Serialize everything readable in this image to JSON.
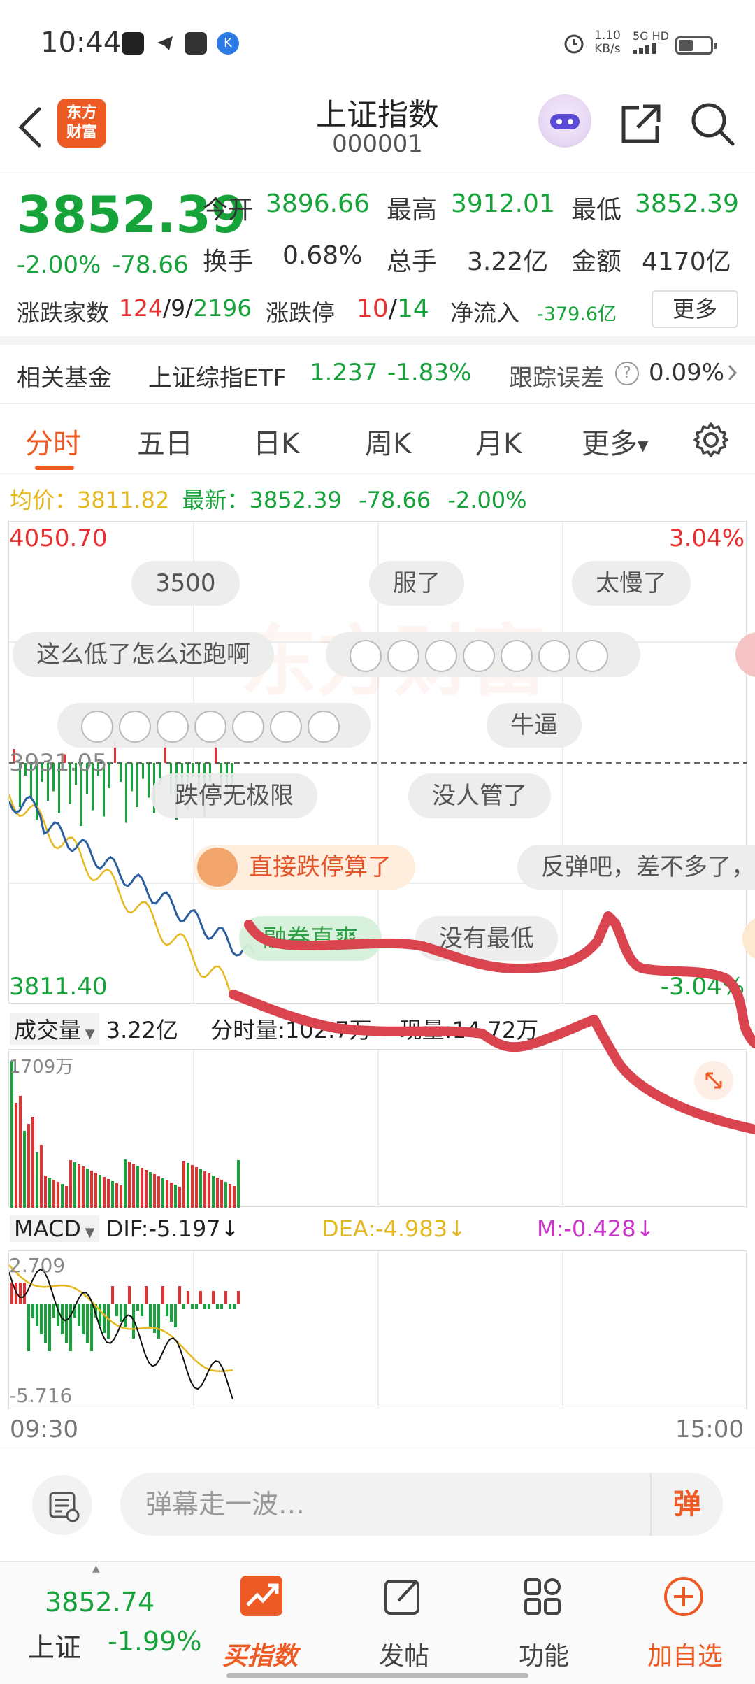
{
  "status_bar": {
    "time": "10:44",
    "net_speed": "1.10",
    "net_unit": "KB/s",
    "signal": "5G HD",
    "battery_level": 0.45
  },
  "header": {
    "logo_line1": "东方",
    "logo_line2": "财富",
    "title": "上证指数",
    "code": "000001"
  },
  "quote": {
    "price": "3852.39",
    "change_pct": "-2.00%",
    "change": "-78.66",
    "open_label": "今开",
    "open": "3896.66",
    "high_label": "最高",
    "high": "3912.01",
    "low_label": "最低",
    "low": "3852.39",
    "turnover_label": "换手",
    "turnover": "0.68%",
    "volume_label": "总手",
    "volume": "3.22亿",
    "amount_label": "金额",
    "amount": "4170亿",
    "breadth_label": "涨跌家数",
    "up_count": "124",
    "flat_count": "9",
    "down_count": "2196",
    "limit_label": "涨跌停",
    "limit_up": "10",
    "limit_down": "14",
    "netflow_label": "净流入",
    "netflow": "-379.6亿",
    "more_btn": "更多",
    "sep": "/"
  },
  "fund": {
    "label": "相关基金",
    "name": "上证综指ETF",
    "price": "1.237",
    "change": "-1.83%",
    "tracking_label": "跟踪误差",
    "help": "?",
    "tracking": "0.09%"
  },
  "tabs": [
    {
      "label": "分时"
    },
    {
      "label": "五日"
    },
    {
      "label": "日K"
    },
    {
      "label": "周K"
    },
    {
      "label": "月K"
    },
    {
      "label": "更多"
    }
  ],
  "avg_line": {
    "avg_label": "均价：",
    "avg_value": "3811.82",
    "latest_label": "最新：",
    "latest_value": "3852.39",
    "change": "-78.66",
    "change_pct": "-2.00%"
  },
  "chart": {
    "y_top": "4050.70",
    "y_mid": "3931.05",
    "y_bottom": "3811.40",
    "pct_top": "3.04%",
    "pct_bottom": "-3.04%",
    "watermark": "东方财富"
  },
  "barrage": [
    {
      "text": "3500"
    },
    {
      "text": "服了"
    },
    {
      "text": "太慢了"
    },
    {
      "text": "这么低了怎么还跑啊"
    },
    {
      "text": "牛逼"
    },
    {
      "text": "跌停无极限"
    },
    {
      "text": "没人管了"
    },
    {
      "text": "直接跌停算了"
    },
    {
      "text": "反弹吧，差不多了，"
    },
    {
      "text": "融券直爽"
    },
    {
      "text": "没有最低"
    }
  ],
  "volume_panel": {
    "label": "成交量",
    "total": "3.22亿",
    "minute_label": "分时量:",
    "minute_value": "102.7万",
    "current_label": "现量:",
    "current_value": "14.72万",
    "max": "1709万"
  },
  "macd": {
    "label": "MACD",
    "dif": "DIF:-5.197",
    "dea": "DEA:-4.983",
    "m": "M:-0.428",
    "arrow": "↓",
    "top": "2.709",
    "bottom": "-5.716"
  },
  "time_axis": {
    "start": "09:30",
    "end": "15:00"
  },
  "comment_bar": {
    "placeholder": "弹幕走一波…",
    "danmu": "弹"
  },
  "bottom_nav": {
    "index_value": "3852.74",
    "index_name": "上证",
    "index_change": "-1.99%",
    "items": [
      {
        "label": "买指数"
      },
      {
        "label": "发帖"
      },
      {
        "label": "功能"
      },
      {
        "label": "加自选"
      }
    ]
  },
  "colors": {
    "accent": "#ee5a24",
    "down": "#15a33a",
    "up": "#e93030",
    "avg_line": "#e6b820",
    "price_line": "#2c5f9e",
    "dea": "#e6b820",
    "m": "#cc33cc",
    "scribble": "#d9444f"
  }
}
